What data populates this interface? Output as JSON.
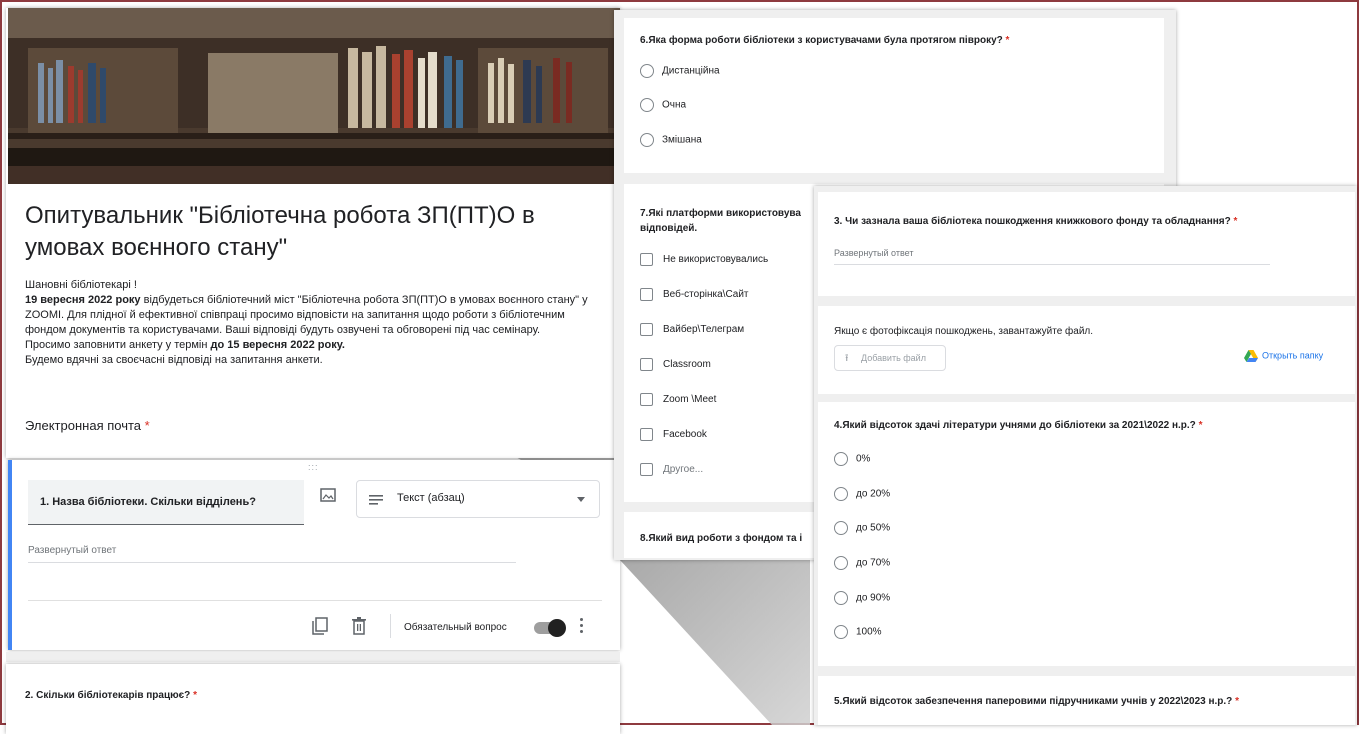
{
  "form": {
    "title": "Опитувальник \"Бібліотечна робота ЗП(ПТ)О в умовах воєнного стану\"",
    "greeting": "Шановні бібліотекарі !",
    "desc_bold1": "19 вересня 2022 року",
    "desc_text1": " відбудеться бібліотечний міст \"Бібліотечна робота ЗП(ПТ)О в умовах воєнного стану\" у ZOOMI. Для плідної й ефективної співпраці просимо відповісти на запитання щодо роботи з бібліотечним фондом документів та користувачами. Ваші відповіді будуть озвучені та обговорені під час семінару.",
    "desc_text2": "Просимо заповнити анкету у термін ",
    "desc_bold2": "до 15 вересня 2022 року.",
    "desc_text3": "Будемо вдячні за своєчасні відповіді на запитання анкети.",
    "email_label": "Электронная почта",
    "required_mark": "*"
  },
  "editor": {
    "drag_handle": ":::",
    "question_title": "1. Назва бібліотеки. Скільки відділень?",
    "type_select": "Текст (абзац)",
    "answer_placeholder": "Развернутый ответ",
    "required_label": "Обязательный вопрос"
  },
  "q2": {
    "title": "2. Скільки бібліотекарів працює?",
    "req": "*"
  },
  "q6": {
    "title": "6.Яка форма роботи бібліотеки з користувачами була протягом півроку?",
    "req": "*",
    "options": [
      "Дистанційна",
      "Очна",
      "Змішана"
    ]
  },
  "q7": {
    "title_line1": "7.Які платформи використовува",
    "title_line2": "відповідей.",
    "options": [
      "Не використовувались",
      "Веб-сторінка\\Сайт",
      "Вайбер\\Телеграм",
      "Classroom",
      "Zoom \\Meet",
      "Facebook",
      "Другое..."
    ]
  },
  "q8": {
    "title": "8.Який вид роботи з фондом та і"
  },
  "q3": {
    "title": "3. Чи зазнала ваша бібліотека пошкодження книжкового фонду та обладнання?",
    "req": "*",
    "placeholder": "Развернутый ответ"
  },
  "upload": {
    "text": "Якщо є фотофіксація пошкоджень, завантажуйте файл.",
    "button": "Добавить файл",
    "folder_link": "Открыть папку"
  },
  "q4": {
    "title": "4.Який відсоток здачі літератури учнями до бібліотеки за 2021\\2022 н.р.?",
    "req": "*",
    "options": [
      "0%",
      "до 20%",
      "до 50%",
      "до 70%",
      "до 90%",
      "100%"
    ]
  },
  "q5": {
    "title": "5.Який відсоток забезпечення паперовими підручниками учнів у 2022\\2023 н.р.?",
    "req": "*"
  },
  "colors": {
    "accent": "#4285f4",
    "required": "#d93025",
    "frame": "#8e3a3f",
    "toggle_track": "#9e9e9e",
    "toggle_knob": "#212121"
  }
}
